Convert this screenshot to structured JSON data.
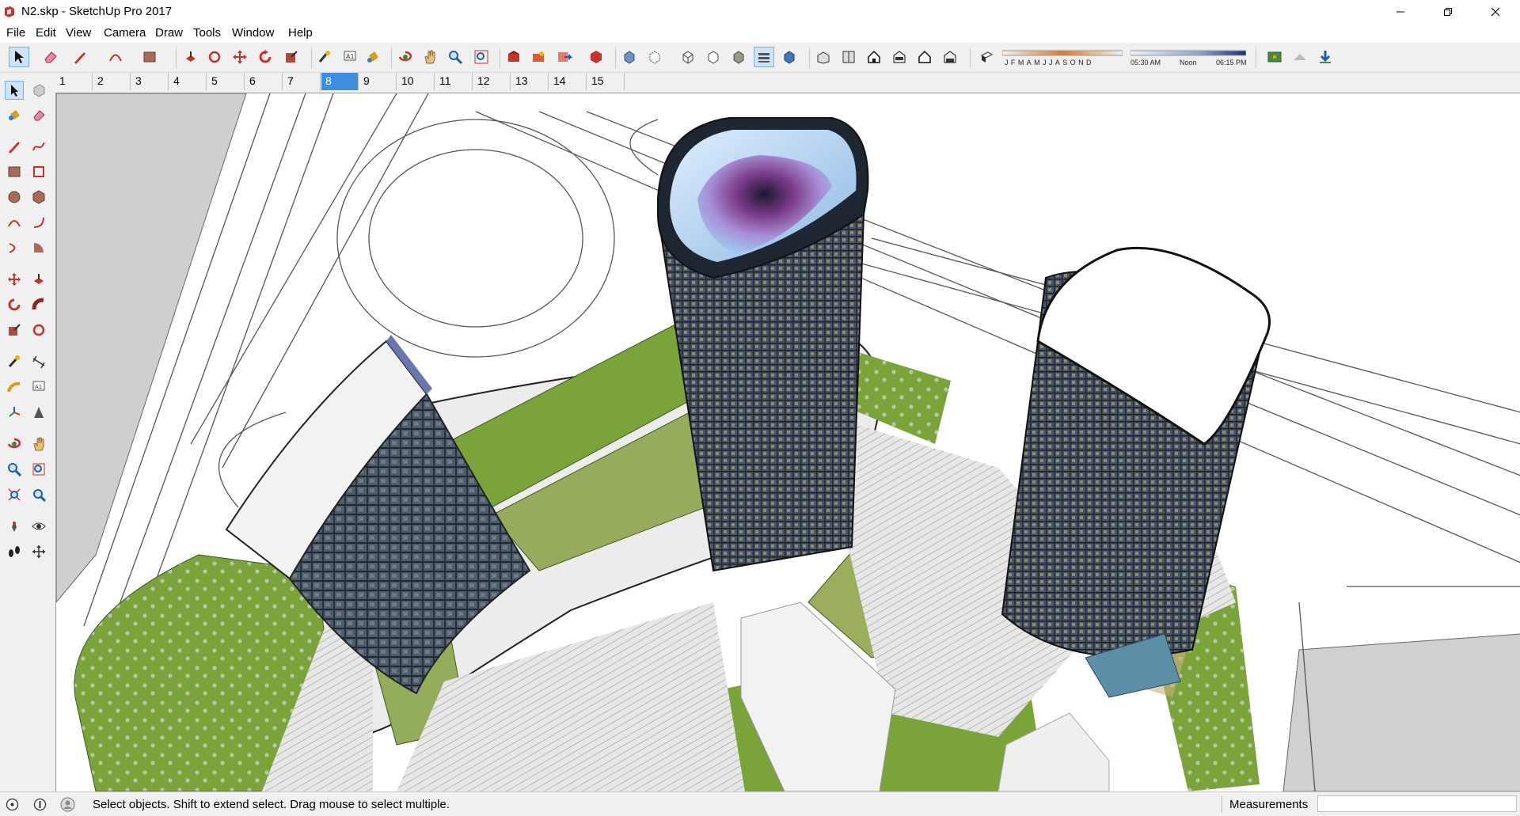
{
  "window": {
    "title": "N2.skp - SketchUp Pro 2017"
  },
  "menu": [
    "File",
    "Edit",
    "View",
    "Camera",
    "Draw",
    "Tools",
    "Window",
    "Help"
  ],
  "shadows": {
    "months": [
      "J",
      "F",
      "M",
      "A",
      "M",
      "J",
      "J",
      "A",
      "S",
      "O",
      "N",
      "D"
    ],
    "times": [
      "05:30 AM",
      "Noon",
      "06:15 PM"
    ]
  },
  "scenes": {
    "tabs": [
      "1",
      "2",
      "3",
      "4",
      "5",
      "6",
      "7",
      "8",
      "9",
      "10",
      "11",
      "12",
      "13",
      "14",
      "15"
    ],
    "active": "8"
  },
  "status": {
    "hint": "Select objects. Shift to extend select. Drag mouse to select multiple.",
    "measurements_label": "Measurements",
    "measurements_value": ""
  },
  "colors": {
    "accent": "#3c8fe0",
    "lawn": "#7aa43a",
    "glass": "#4a5868",
    "roof": "#b9d7f2"
  }
}
